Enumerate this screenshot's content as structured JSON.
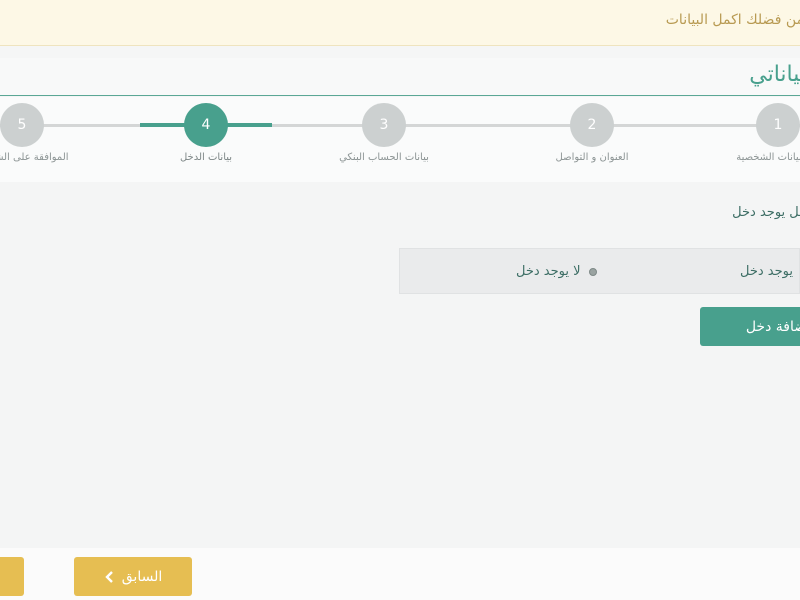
{
  "alert": {
    "text": "من فضلك اكمل البيانات"
  },
  "header": {
    "title": "بياناتي"
  },
  "wizard": {
    "steps": [
      {
        "number": "1",
        "label": "البيانات الشخصية"
      },
      {
        "number": "2",
        "label": "العنوان و التواصل"
      },
      {
        "number": "3",
        "label": "بيانات الحساب البنكي"
      },
      {
        "number": "4",
        "label": "بيانات الدخل"
      },
      {
        "number": "5",
        "label": "الموافقة على الشروط"
      }
    ],
    "active_step": "4"
  },
  "income": {
    "section_label": "هل يوجد دخل",
    "options": [
      {
        "label": "يوجد دخل"
      },
      {
        "label": "لا يوجد دخل"
      }
    ],
    "add_button": "إضافة دخل"
  },
  "footer": {
    "prev_label": "السابق"
  },
  "colors": {
    "accent": "#48a08d",
    "warning": "#e6be52",
    "alert_bg": "#fdf8e6"
  }
}
